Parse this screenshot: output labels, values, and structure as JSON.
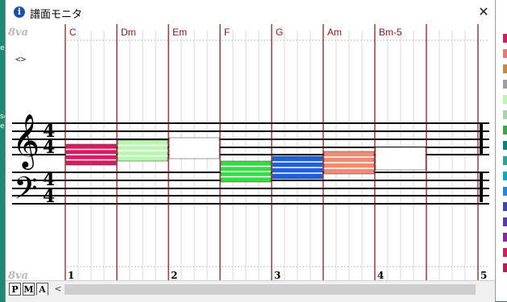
{
  "window": {
    "title": "譜面モニタ",
    "info_icon": "i",
    "close_glyph": "✕"
  },
  "left_fragments": [
    "e",
    "se",
    "ea"
  ],
  "score": {
    "octave_top": "8va",
    "octave_bottom": "8va",
    "nav_symbol": "<>",
    "time_signature": {
      "numerator": "4",
      "denominator": "4"
    },
    "treble_clef": "𝄞",
    "bass_clef": "𝄢",
    "chords": [
      "C",
      "Dm",
      "Em",
      "F",
      "G",
      "Am",
      "Bm-5"
    ],
    "chord_colors": [
      "#d81b60",
      "#b9f6b0",
      "#ffffff",
      "#33dd44",
      "#1e5fe0",
      "#f08a70",
      "#ffffff"
    ],
    "measure_numbers": [
      "1",
      "2",
      "3",
      "4",
      "5"
    ]
  },
  "bottom": {
    "modes": [
      "P",
      "M",
      "A"
    ],
    "active_mode": "A",
    "scroll_left": "<"
  },
  "right_panel_colors": [
    "#d81b60",
    "#e67c73",
    "#c68a3c",
    "#9e9e9e",
    "#b9f6b0",
    "#a5d6a7",
    "#33aa44",
    "#00897b",
    "#26a69a",
    "#00acc1",
    "#1e88e5",
    "#3949ab",
    "#5e35b1",
    "#8e24aa",
    "#d81b60",
    "#c2185b"
  ]
}
